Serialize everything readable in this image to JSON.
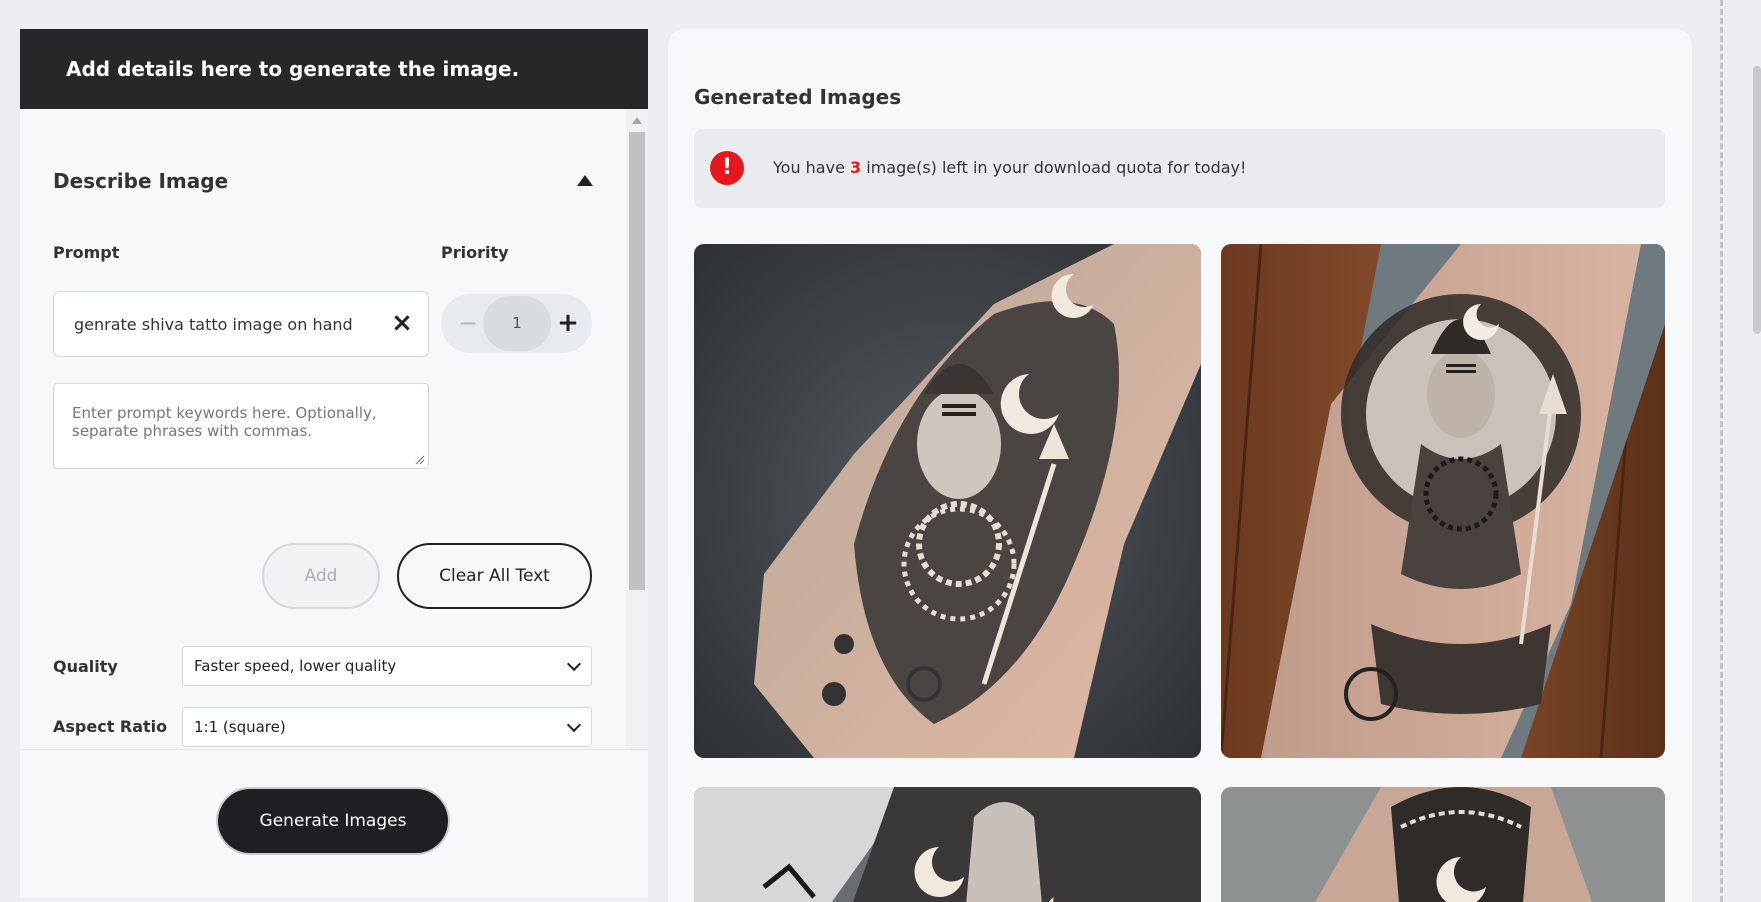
{
  "left_panel": {
    "header_title": "Add details here to generate the image.",
    "section_title": "Describe Image",
    "prompt_label": "Prompt",
    "priority_label": "Priority",
    "prompt_chip_text": "genrate shiva tatto image on hand",
    "priority_value": "1",
    "keyword_placeholder": "Enter prompt keywords here. Optionally, separate phrases with commas.",
    "add_label": "Add",
    "clear_label": "Clear All Text",
    "quality_label": "Quality",
    "quality_value": "Faster speed, lower quality",
    "aspect_label": "Aspect Ratio",
    "aspect_value": "1:1 (square)",
    "generate_label": "Generate Images"
  },
  "right_panel": {
    "title": "Generated Images",
    "quota_prefix": "You have ",
    "quota_count": "3",
    "quota_suffix": " image(s) left in your download quota for today!"
  },
  "icons": {
    "alert": "alert-circle-icon",
    "close": "close-icon",
    "minus": "minus-icon",
    "plus": "plus-icon",
    "collapse": "caret-up-icon",
    "chevron": "chevron-down-icon"
  },
  "colors": {
    "header_bg": "#262729",
    "alert_red": "#e5181f",
    "generate_bg": "#1d1f22"
  }
}
